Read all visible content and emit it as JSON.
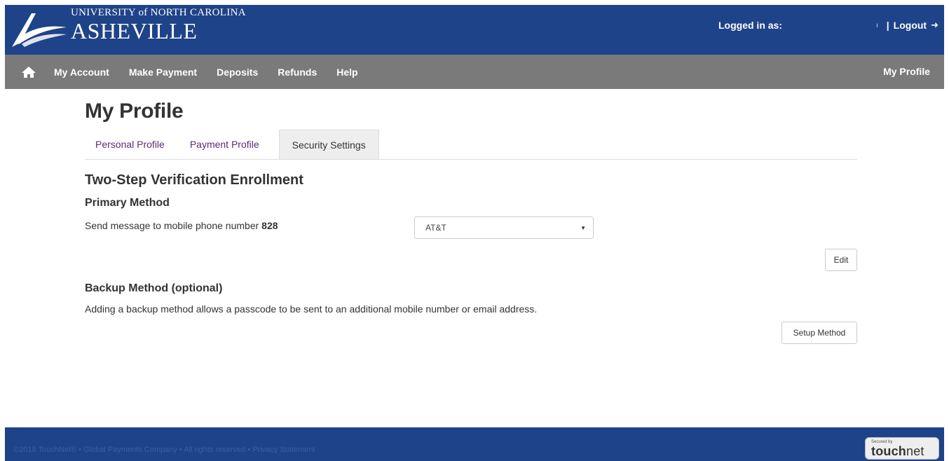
{
  "header": {
    "logo_univ": "UNIVERSITY of NORTH CAROLINA",
    "logo_city": "ASHEVILLE",
    "logged_in_label": "Logged in as:",
    "logout_label": "Logout"
  },
  "nav": {
    "items": [
      "My Account",
      "Make Payment",
      "Deposits",
      "Refunds",
      "Help"
    ],
    "right": "My Profile"
  },
  "page": {
    "title": "My Profile",
    "tabs": [
      {
        "label": "Personal Profile"
      },
      {
        "label": "Payment Profile"
      },
      {
        "label": "Security Settings"
      }
    ],
    "section_title": "Two-Step Verification Enrollment",
    "primary": {
      "title": "Primary Method",
      "text": "Send message to mobile phone number",
      "number": "828",
      "carrier": "AT&T",
      "edit_label": "Edit"
    },
    "backup": {
      "title": "Backup Method (optional)",
      "text": "Adding a backup method allows a passcode to be sent to an additional mobile number or email address.",
      "setup_label": "Setup Method"
    }
  },
  "footer": {
    "text": "©2018 TouchNet® • Global Payments Company • All rights reserved • Privacy Statement",
    "badge_small": "Secured by",
    "badge_bold": "touch",
    "badge_light": "net"
  },
  "colors": {
    "header_bg": "#1e4388",
    "nav_bg": "#7a7a7a",
    "tab_link": "#5b2c7a"
  }
}
